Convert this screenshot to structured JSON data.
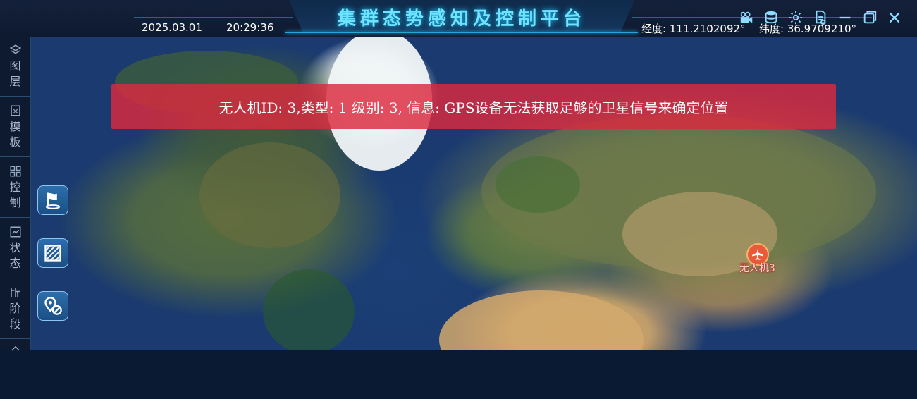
{
  "header": {
    "title": "集群态势感知及控制平台",
    "date": "2025.03.01",
    "time": "20:29:36",
    "longitude": "经度: 111.2102092°",
    "latitude": "纬度: 36.9709210°",
    "icons": [
      "video-camera-icon",
      "database-icon",
      "gear-icon",
      "document-icon",
      "minimize-icon",
      "restore-icon",
      "close-icon"
    ]
  },
  "sidebar": {
    "items": [
      {
        "label": "图层",
        "icon": "layers-icon"
      },
      {
        "label": "模板",
        "icon": "template-icon"
      },
      {
        "label": "控制",
        "icon": "grid-icon"
      },
      {
        "label": "状态",
        "icon": "chart-icon"
      },
      {
        "label": "阶段",
        "icon": "phase-icon"
      }
    ]
  },
  "tools": [
    "flag-icon",
    "area-select-icon",
    "location-cancel-icon"
  ],
  "alert": {
    "message": "无人机ID: 3,类型: 1 级别: 3, 信息: GPS设备无法获取足够的卫星信号来确定位置",
    "color": "#dc2a3e"
  },
  "marker": {
    "label": "无人机3",
    "icon": "airplane-icon",
    "color": "#e85a3a"
  },
  "colors": {
    "accent": "#6fe3ff",
    "panel": "#0e1a30"
  }
}
